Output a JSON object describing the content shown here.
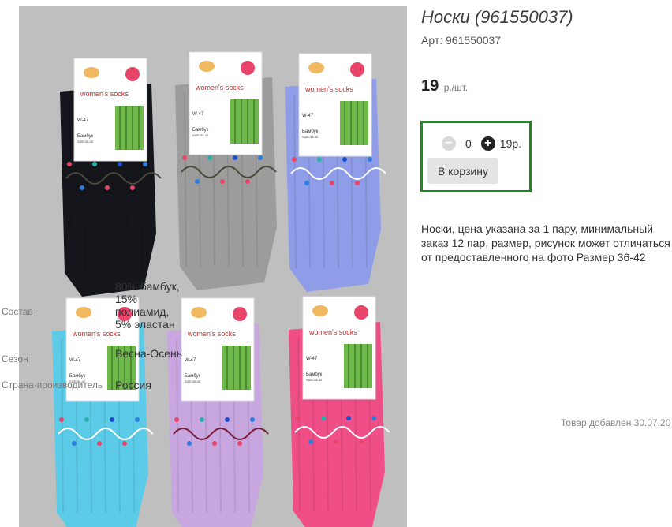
{
  "product": {
    "title": "Носки (961550037)",
    "sku": "Арт: 961550037",
    "price_value": "19",
    "price_unit": "р./шт."
  },
  "buy_box": {
    "minus_symbol": "−",
    "quantity": "0",
    "plus_symbol": "+",
    "line_total": "19р.",
    "cart_button_label": "В корзину",
    "border_color": "#1e8a1e"
  },
  "description": "Носки, цена указана за 1 пару, минимальный заказ 12 пар, размер, рисунок может отличаться от предоставленного на фото Размер 36-42",
  "properties": [
    {
      "label": "Состав",
      "value": "80% бамбук, 15% полиамид, 5% эластан"
    },
    {
      "label": "Сезон",
      "value": "Весна-Осень"
    },
    {
      "label": "Страна-производитель",
      "value": "Россия"
    }
  ],
  "added_note": "Товар добавлен 30.07.20",
  "photo": {
    "tag_brand": "women's socks",
    "tag_model": "W-47",
    "tag_material": "Бамбук",
    "tag_size": "SIZE:36-42",
    "sock_colors": [
      "#14161c",
      "#9c9c9c",
      "#8f9ce8",
      "#5ccbe8",
      "#c8a6df",
      "#ef4f86"
    ]
  }
}
